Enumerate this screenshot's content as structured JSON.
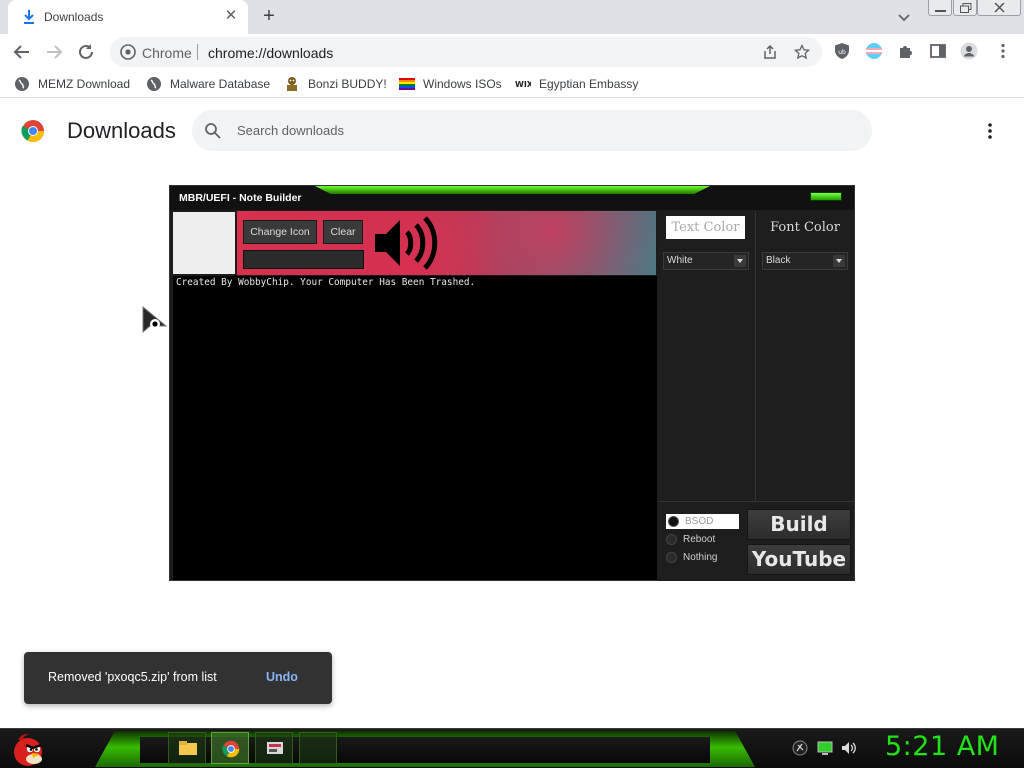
{
  "browser": {
    "tab": {
      "title": "Downloads"
    },
    "omnibox": {
      "origin": "Chrome",
      "url": "chrome://downloads"
    },
    "bookmarks": [
      {
        "label": "MEMZ Download",
        "icon": "globe-icon"
      },
      {
        "label": "Malware Database",
        "icon": "globe-icon"
      },
      {
        "label": "Bonzi BUDDY!",
        "icon": "bonzi-icon"
      },
      {
        "label": "Windows ISOs",
        "icon": "rainbow-flag-icon"
      },
      {
        "label": "Egyptian Embassy",
        "icon": "wix-icon"
      }
    ]
  },
  "downloads_page": {
    "title": "Downloads",
    "search_placeholder": "Search downloads"
  },
  "note_builder": {
    "title": "MBR/UEFI - Note Builder",
    "change_icon_label": "Change Icon",
    "clear_label": "Clear",
    "note_text": "Created By WobbyChip. Your Computer Has Been Trashed.",
    "text_color_label": "Text Color",
    "font_color_label": "Font Color",
    "text_color_value": "White",
    "font_color_value": "Black",
    "radio_options": [
      {
        "label": "BSOD",
        "selected": true
      },
      {
        "label": "Reboot",
        "selected": false
      },
      {
        "label": "Nothing",
        "selected": false
      }
    ],
    "build_label": "Build",
    "youtube_label": "YouTube"
  },
  "toast": {
    "message": "Removed 'pxoqc5.zip' from list",
    "undo_label": "Undo"
  },
  "taskbar": {
    "clock": "5:21 AM"
  },
  "colors": {
    "accent_green": "#22e31a",
    "chrome_blue": "#1a73e8",
    "toast_link": "#8ab4f8"
  }
}
